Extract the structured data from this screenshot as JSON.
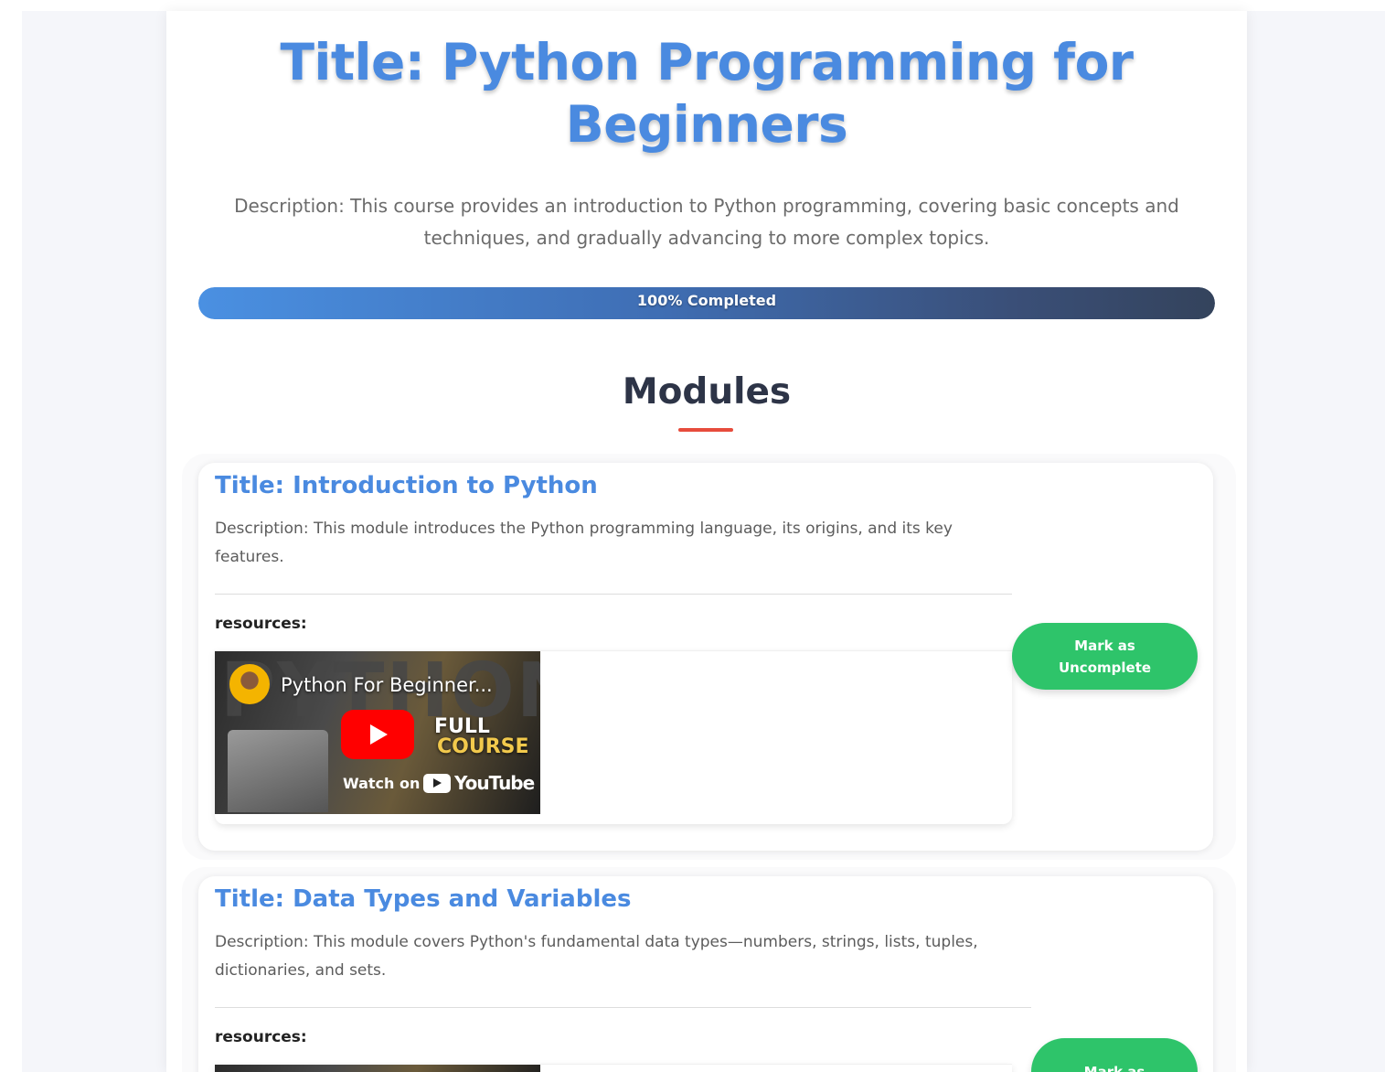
{
  "course": {
    "title": "Title: Python Programming for Beginners",
    "description": "Description: This course provides an introduction to Python programming, covering basic concepts and techniques, and gradually advancing to more complex topics.",
    "progress_percent": 100,
    "progress_label": "100% Completed"
  },
  "modules_section": {
    "heading": "Modules"
  },
  "modules": [
    {
      "title": "Title: Introduction to Python",
      "description": "Description: This module introduces the Python programming language, its origins, and its key features.",
      "resources_label": "resources:",
      "button_label": "Mark as Uncomplete",
      "video": {
        "title": "Python For Beginner...",
        "big_text": "PYTHON",
        "full_text": "FULL",
        "course_text": "COURSE",
        "watch_on": "Watch on",
        "platform": "YouTube"
      }
    },
    {
      "title": "Title: Data Types and Variables",
      "description": "Description: This module covers Python's fundamental data types—numbers, strings, lists, tuples, dictionaries, and sets.",
      "resources_label": "resources:",
      "button_label": "Mark as"
    }
  ],
  "colors": {
    "accent_blue": "#4a8ae0",
    "success_green": "#2ec46a",
    "heading_underline_red": "#e74c3c",
    "heading_dark": "#2d3447"
  }
}
